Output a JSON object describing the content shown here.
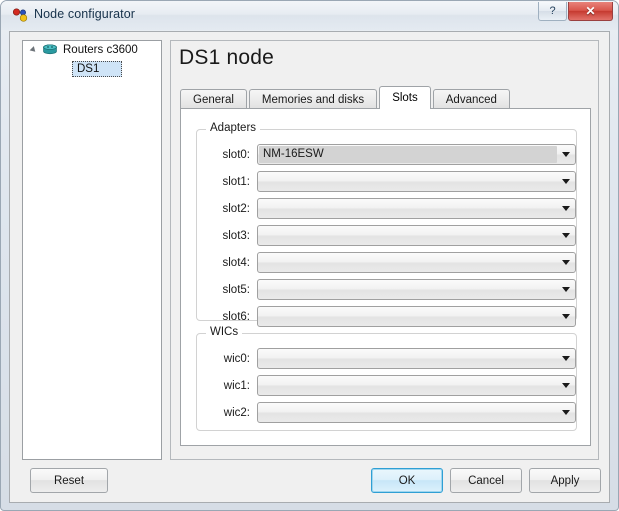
{
  "window": {
    "title": "Node configurator",
    "app_icon": "node-configurator-icon",
    "help_button": "?",
    "close_button": "✕"
  },
  "tree": {
    "root": {
      "label": "Routers c3600",
      "icon": "router-icon",
      "expanded": true
    },
    "child": {
      "label": "DS1",
      "selected": true
    }
  },
  "pane": {
    "title": "DS1 node",
    "tabs": [
      {
        "label": "General",
        "active": false
      },
      {
        "label": "Memories and disks",
        "active": false
      },
      {
        "label": "Slots",
        "active": true
      },
      {
        "label": "Advanced",
        "active": false
      }
    ]
  },
  "adapters": {
    "title": "Adapters",
    "rows": [
      {
        "label": "slot0:",
        "value": "NM-16ESW"
      },
      {
        "label": "slot1:",
        "value": ""
      },
      {
        "label": "slot2:",
        "value": ""
      },
      {
        "label": "slot3:",
        "value": ""
      },
      {
        "label": "slot4:",
        "value": ""
      },
      {
        "label": "slot5:",
        "value": ""
      },
      {
        "label": "slot6:",
        "value": ""
      }
    ]
  },
  "wics": {
    "title": "WICs",
    "rows": [
      {
        "label": "wic0:",
        "value": ""
      },
      {
        "label": "wic1:",
        "value": ""
      },
      {
        "label": "wic2:",
        "value": ""
      }
    ]
  },
  "buttons": {
    "reset": "Reset",
    "ok": "OK",
    "cancel": "Cancel",
    "apply": "Apply"
  },
  "colors": {
    "accent": "#2f9fd4",
    "close": "#c5392f",
    "selection": "#cfe4f7",
    "router_icon": "#2a9aa0"
  }
}
